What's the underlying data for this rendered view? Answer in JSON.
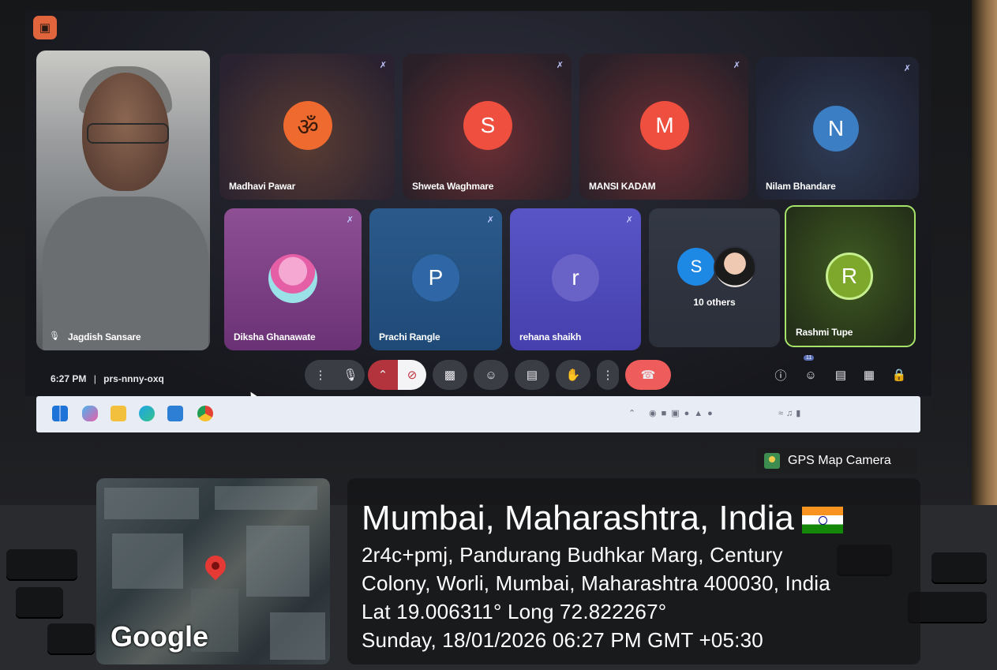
{
  "meeting": {
    "time": "6:27 PM",
    "separator": "|",
    "code": "prs-nnny-oxq",
    "raised_hands_count": "11",
    "participants": [
      {
        "name": "Jagdish Sansare",
        "type": "video"
      },
      {
        "name": "Madhavi Pawar",
        "initial": "ॐ",
        "color": "#ee6a2f"
      },
      {
        "name": "Shweta Waghmare",
        "initial": "S",
        "color": "#ef4f3f"
      },
      {
        "name": "MANSI KADAM",
        "initial": "M",
        "color": "#ef4f3f"
      },
      {
        "name": "Nilam Bhandare",
        "initial": "N",
        "color": "#3b7ec4"
      },
      {
        "name": "Diksha Ghanawate",
        "initial": "",
        "color": "#e46bb2"
      },
      {
        "name": "Prachi Rangle",
        "initial": "P",
        "color": "#2e66a6"
      },
      {
        "name": "rehana shaikh",
        "initial": "r",
        "color": "#6a63c7"
      },
      {
        "name": "Rashmi Tupe",
        "initial": "R",
        "color": "#7da82b"
      }
    ],
    "others": {
      "initial": "S",
      "label": "10 others",
      "color": "#1e88e5"
    },
    "controls": [
      "audio-settings",
      "microphone",
      "more-camera",
      "camera-off",
      "present",
      "reactions",
      "captions",
      "raise-hand",
      "more-options",
      "leave-call"
    ],
    "right_controls": [
      "info",
      "people",
      "chat",
      "activities",
      "host-controls"
    ]
  },
  "gps": {
    "badge": "GPS Map Camera",
    "map_logo": "Google",
    "location": "Mumbai, Maharashtra, India",
    "address_line1": "2r4c+pmj, Pandurang Budhkar Marg, Century",
    "address_line2": "Colony, Worli, Mumbai, Maharashtra 400030, India",
    "coords": "Lat 19.006311° Long 72.822267°",
    "datetime": "Sunday, 18/01/2026 06:27 PM GMT +05:30"
  },
  "colors": {
    "leave": "#ee5c5c",
    "active_ring": "#a6e36b",
    "control_bg": "#3b3d44"
  }
}
